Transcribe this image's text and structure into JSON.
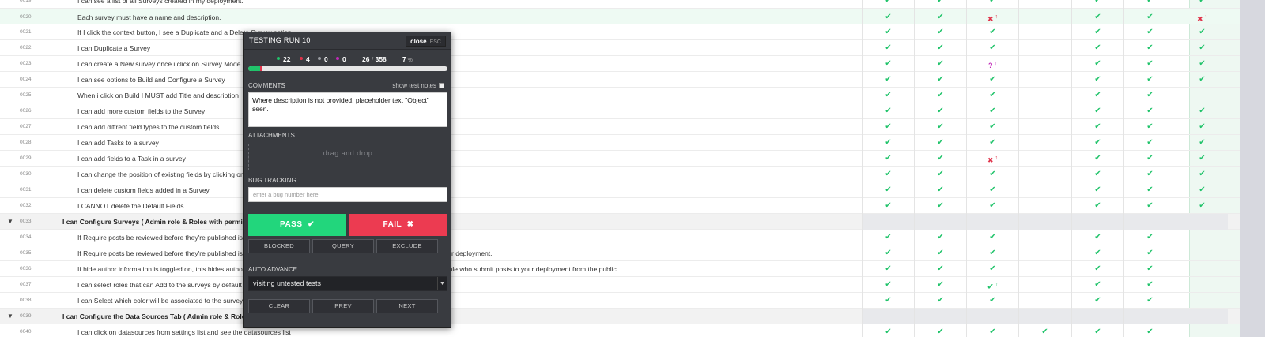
{
  "rows": [
    {
      "num": "0019",
      "text": "I can see a list of all Surveys created in my deployment.",
      "kind": "item",
      "cells": [
        "pass",
        "pass",
        "pass",
        "",
        "pass",
        "pass",
        "pass"
      ]
    },
    {
      "num": "0020",
      "text": "Each survey must have a name and description.",
      "kind": "item",
      "highlight": true,
      "cells": [
        "pass",
        "pass",
        "fail",
        "",
        "pass",
        "pass",
        "fail"
      ]
    },
    {
      "num": "0021",
      "text": "If I click the context button, I see a Duplicate and a Delete Survey action",
      "kind": "item",
      "cells": [
        "pass",
        "pass",
        "pass",
        "",
        "pass",
        "pass",
        "pass"
      ]
    },
    {
      "num": "0022",
      "text": "I can Duplicate a Survey",
      "kind": "item",
      "cells": [
        "pass",
        "pass",
        "pass",
        "",
        "pass",
        "pass",
        "pass"
      ]
    },
    {
      "num": "0023",
      "text": "I can create a New survey once i click on Survey Mode",
      "kind": "item",
      "cells": [
        "pass",
        "pass",
        "question",
        "",
        "pass",
        "pass",
        "pass"
      ]
    },
    {
      "num": "0024",
      "text": "I can see options to Build and Configure a Survey",
      "kind": "item",
      "cells": [
        "pass",
        "pass",
        "pass",
        "",
        "pass",
        "pass",
        "pass"
      ]
    },
    {
      "num": "0025",
      "text": "When i click on Build I MUST add Title and description",
      "kind": "item",
      "cells": [
        "pass",
        "pass",
        "pass",
        "",
        "pass",
        "pass",
        ""
      ]
    },
    {
      "num": "0026",
      "text": "I can add more custom fields to the Survey",
      "kind": "item",
      "cells": [
        "pass",
        "pass",
        "pass",
        "",
        "pass",
        "pass",
        "pass"
      ]
    },
    {
      "num": "0027",
      "text": "I can add diffrent field types to the custom fields",
      "kind": "item",
      "cells": [
        "pass",
        "pass",
        "pass",
        "",
        "pass",
        "pass",
        "pass"
      ]
    },
    {
      "num": "0028",
      "text": "I can add Tasks to a survey",
      "kind": "item",
      "cells": [
        "pass",
        "pass",
        "pass",
        "",
        "pass",
        "pass",
        "pass"
      ]
    },
    {
      "num": "0029",
      "text": "I can add fields to a Task in a survey",
      "kind": "item",
      "cells": [
        "pass",
        "pass",
        "fail",
        "",
        "pass",
        "pass",
        "pass"
      ]
    },
    {
      "num": "0030",
      "text": "I can change the position of existing fields by clicking on",
      "kind": "item",
      "cells": [
        "pass",
        "pass",
        "pass",
        "",
        "pass",
        "pass",
        "pass"
      ]
    },
    {
      "num": "0031",
      "text": "I can delete custom fields added in a Survey",
      "kind": "item",
      "cells": [
        "pass",
        "pass",
        "pass",
        "",
        "pass",
        "pass",
        "pass"
      ]
    },
    {
      "num": "0032",
      "text": "I CANNOT delete the Default Fields",
      "kind": "item",
      "cells": [
        "pass",
        "pass",
        "pass",
        "",
        "pass",
        "pass",
        "pass"
      ]
    },
    {
      "num": "0033",
      "text": "I can Configure Surveys  ( Admin role & Roles with permissions )",
      "kind": "group",
      "cells": [
        "",
        "",
        "",
        "",
        "",
        "",
        ""
      ]
    },
    {
      "num": "0034",
      "text": "If Require posts be reviewed before they're published is toggled on, posts submitted to this survey will be reviewed",
      "kind": "item",
      "cells": [
        "pass",
        "pass",
        "pass",
        "",
        "pass",
        "pass",
        ""
      ]
    },
    {
      "num": "0035",
      "text": "If Require posts be reviewed before they're published is toggled off, posts are published as soon as they are submitted on your deployment.",
      "kind": "item",
      "cells": [
        "pass",
        "pass",
        "pass",
        "",
        "pass",
        "pass",
        ""
      ]
    },
    {
      "num": "0036",
      "text": "If hide author information is toggled on, this hides author information like names, phone numbers and email addresses of people who submit posts to your deployment from the public.",
      "kind": "item",
      "cells": [
        "pass",
        "pass",
        "pass",
        "",
        "pass",
        "pass",
        ""
      ]
    },
    {
      "num": "0037",
      "text": "I can select roles that can Add to the surveys by default",
      "kind": "item",
      "cells": [
        "pass",
        "pass",
        "passup",
        "",
        "pass",
        "pass",
        ""
      ]
    },
    {
      "num": "0038",
      "text": "I can Select which color will be associated to the survey",
      "kind": "item",
      "cells": [
        "pass",
        "pass",
        "pass",
        "",
        "pass",
        "pass",
        ""
      ]
    },
    {
      "num": "0039",
      "text": "I can Configure the Data Sources Tab  ( Admin role & Roles with permissions )",
      "kind": "group",
      "cells": [
        "",
        "",
        "",
        "",
        "",
        "",
        ""
      ]
    },
    {
      "num": "0040",
      "text": "I can click on datasources from settings list and see the datasources list",
      "kind": "item",
      "cells": [
        "pass",
        "pass",
        "pass",
        "pass",
        "pass",
        "pass",
        ""
      ]
    }
  ],
  "glyphs": {
    "pass": "✔",
    "fail": "✖",
    "question": "?",
    "passup": "✔",
    "up": "↑",
    "caret": "▼"
  },
  "colors": {
    "pass": "#20c36a",
    "fail": "#e0334a",
    "question": "#c12ab8",
    "dialog_bg": "#393b40"
  },
  "dialog": {
    "title": "TESTING RUN 10",
    "close_label": "close",
    "esc_label": "ESC",
    "stats": {
      "pass": "22",
      "fail": "4",
      "blocked": "0",
      "other": "0",
      "done": "26",
      "total": "358",
      "percent": "7"
    },
    "comments_label": "COMMENTS",
    "show_notes_label": "show test notes",
    "comment_text": "Where description is not provided, placeholder text \"Object\" seen.",
    "attachments_label": "ATTACHMENTS",
    "dropzone_label": "drag and drop",
    "bug_label": "BUG TRACKING",
    "bug_placeholder": "enter a bug number here",
    "pass_label": "PASS",
    "fail_label": "FAIL",
    "blocked_label": "BLOCKED",
    "query_label": "QUERY",
    "exclude_label": "EXCLUDE",
    "auto_advance_label": "AUTO ADVANCE",
    "auto_advance_value": "visiting untested tests",
    "clear_label": "CLEAR",
    "prev_label": "PREV",
    "next_label": "NEXT"
  }
}
